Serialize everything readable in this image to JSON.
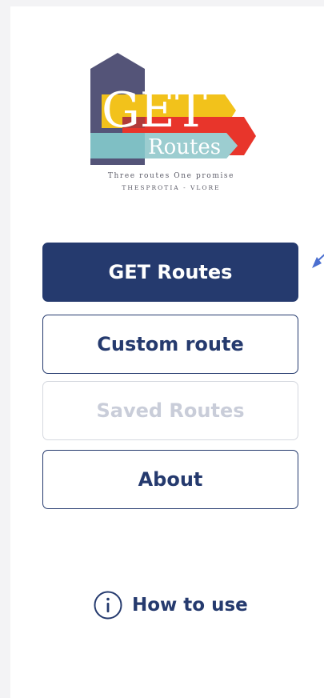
{
  "logo": {
    "word_top": "GET",
    "word_bottom": "Routes",
    "tagline_1": "Three routes One promise",
    "tagline_2": "THESPROTIA - VLORE"
  },
  "menu": {
    "get_routes": "GET Routes",
    "custom_route": "Custom route",
    "saved_routes": "Saved Routes",
    "about": "About"
  },
  "help": {
    "how_to_use": "How to use"
  },
  "colors": {
    "primary": "#253a6e",
    "disabled_text": "#c9cdd9",
    "arrow_accent": "#4b6fd0"
  },
  "icons": {
    "info": "info-icon",
    "pointer": "arrow-pointer-icon"
  }
}
